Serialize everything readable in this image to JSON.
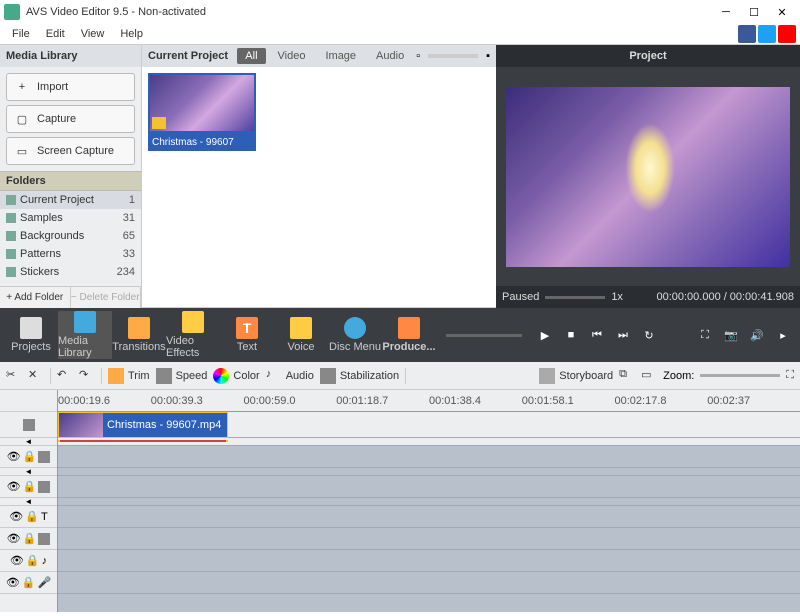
{
  "window": {
    "title": "AVS Video Editor 9.5 - Non-activated"
  },
  "menu": {
    "file": "File",
    "edit": "Edit",
    "view": "View",
    "help": "Help"
  },
  "lib": {
    "header": "Media Library",
    "import_btn": "Import",
    "capture_btn": "Capture",
    "screencap_btn": "Screen Capture",
    "folders_hdr": "Folders",
    "folders": [
      {
        "name": "Current Project",
        "count": "1"
      },
      {
        "name": "Samples",
        "count": "31"
      },
      {
        "name": "Backgrounds",
        "count": "65"
      },
      {
        "name": "Patterns",
        "count": "33"
      },
      {
        "name": "Stickers",
        "count": "234"
      }
    ],
    "add_folder": "+ Add Folder",
    "del_folder": "− Delete Folder"
  },
  "content": {
    "title": "Current Project",
    "tabs": {
      "all": "All",
      "video": "Video",
      "image": "Image",
      "audio": "Audio"
    },
    "thumb_label": "Christmas - 99607"
  },
  "preview": {
    "title": "Project",
    "status": "Paused",
    "speed": "1x",
    "time_cur": "00:00:00.000",
    "time_dur": "00:00:41.908"
  },
  "maintb": {
    "projects": "Projects",
    "media": "Media Library",
    "trans": "Transitions",
    "fx": "Video Effects",
    "text": "Text",
    "voice": "Voice",
    "disc": "Disc Menu",
    "produce": "Produce..."
  },
  "edittb": {
    "trim": "Trim",
    "speed": "Speed",
    "color": "Color",
    "audio": "Audio",
    "stab": "Stabilization",
    "story": "Storyboard",
    "zoom": "Zoom:"
  },
  "ruler": [
    "00:00:19.6",
    "00:00:39.3",
    "00:00:59.0",
    "00:01:18.7",
    "00:01:38.4",
    "00:01:58.1",
    "00:02:17.8",
    "00:02:37"
  ],
  "clip_name": "Christmas - 99607.mp4"
}
